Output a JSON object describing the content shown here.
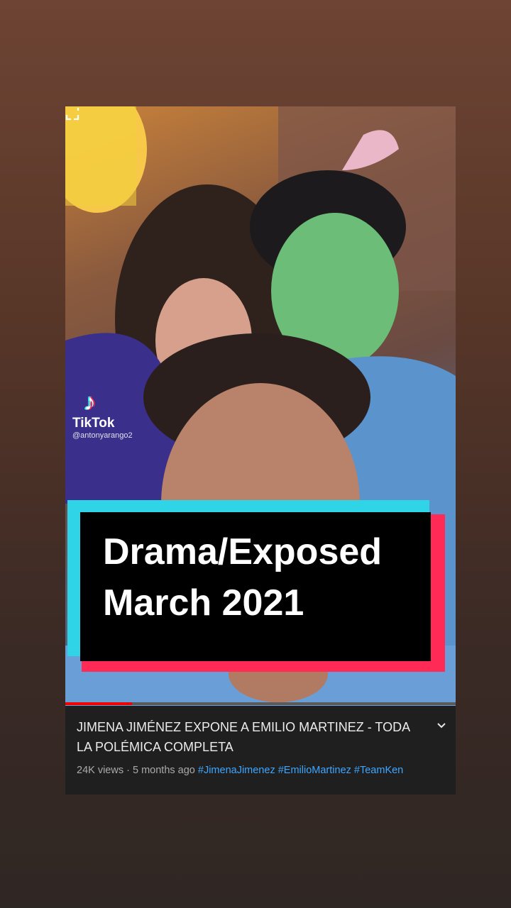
{
  "overlay": {
    "brand": "TikTok",
    "handle": "@antonyarango2",
    "banner_line1": "Drama/Exposed",
    "banner_line2": "March 2021"
  },
  "player": {
    "progress_fraction": 0.17
  },
  "video": {
    "title": "JIMENA JIMÉNEZ EXPONE A EMILIO MARTINEZ - TODA LA POLÉMICA COMPLETA",
    "views": "24K views",
    "separator": " · ",
    "age": "5 months ago",
    "hashtags": [
      "#JimenaJimenez",
      "#EmilioMartinez",
      "#TeamKen"
    ]
  },
  "colors": {
    "banner_cyan": "#2fd4e6",
    "banner_red": "#ff2a55",
    "hashtag": "#3ea6ff",
    "progress": "#ee0000"
  }
}
